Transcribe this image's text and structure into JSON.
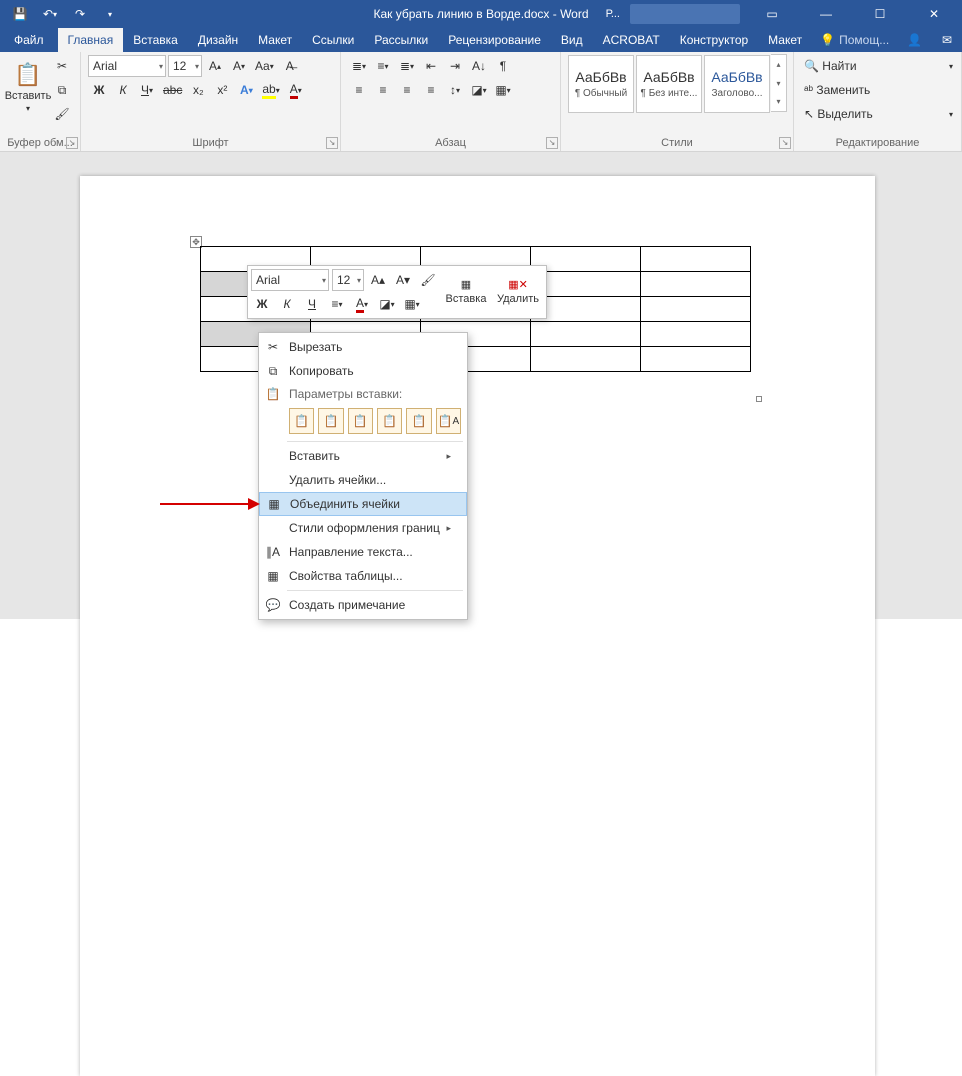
{
  "title": "Как убрать линию в Ворде.docx - Word",
  "account_short": "Р...",
  "tabs": {
    "file": "Файл",
    "home": "Главная",
    "insert": "Вставка",
    "design": "Дизайн",
    "layout": "Макет",
    "references": "Ссылки",
    "mailings": "Рассылки",
    "review": "Рецензирование",
    "view": "Вид",
    "acrobat": "ACROBAT",
    "tbl_design": "Конструктор",
    "tbl_layout": "Макет",
    "tellme": "Помощ..."
  },
  "ribbon": {
    "clipboard": {
      "paste": "Вставить",
      "group": "Буфер обм..."
    },
    "font": {
      "name": "Arial",
      "size": "12",
      "group": "Шрифт",
      "bold": "Ж",
      "italic": "К",
      "underline": "Ч",
      "strike": "abc",
      "sub": "x₂",
      "sup": "x²"
    },
    "para": {
      "group": "Абзац"
    },
    "styles": {
      "group": "Стили",
      "sample": "АаБбВв",
      "s1": "¶ Обычный",
      "s2": "¶ Без инте...",
      "s3": "Заголово..."
    },
    "edit": {
      "group": "Редактирование",
      "find": "Найти",
      "replace": "Заменить",
      "select": "Выделить"
    }
  },
  "minitoolbar": {
    "font": "Arial",
    "size": "12",
    "bold": "Ж",
    "italic": "К",
    "underline": "Ч",
    "insert": "Вставка",
    "delete": "Удалить"
  },
  "context": {
    "cut": "Вырезать",
    "copy": "Копировать",
    "paste_header": "Параметры вставки:",
    "insert": "Вставить",
    "del": "Удалить ячейки...",
    "merge": "Объединить ячейки",
    "borders": "Стили оформления границ",
    "textdir": "Направление текста...",
    "props": "Свойства таблицы...",
    "comment": "Создать примечание"
  }
}
